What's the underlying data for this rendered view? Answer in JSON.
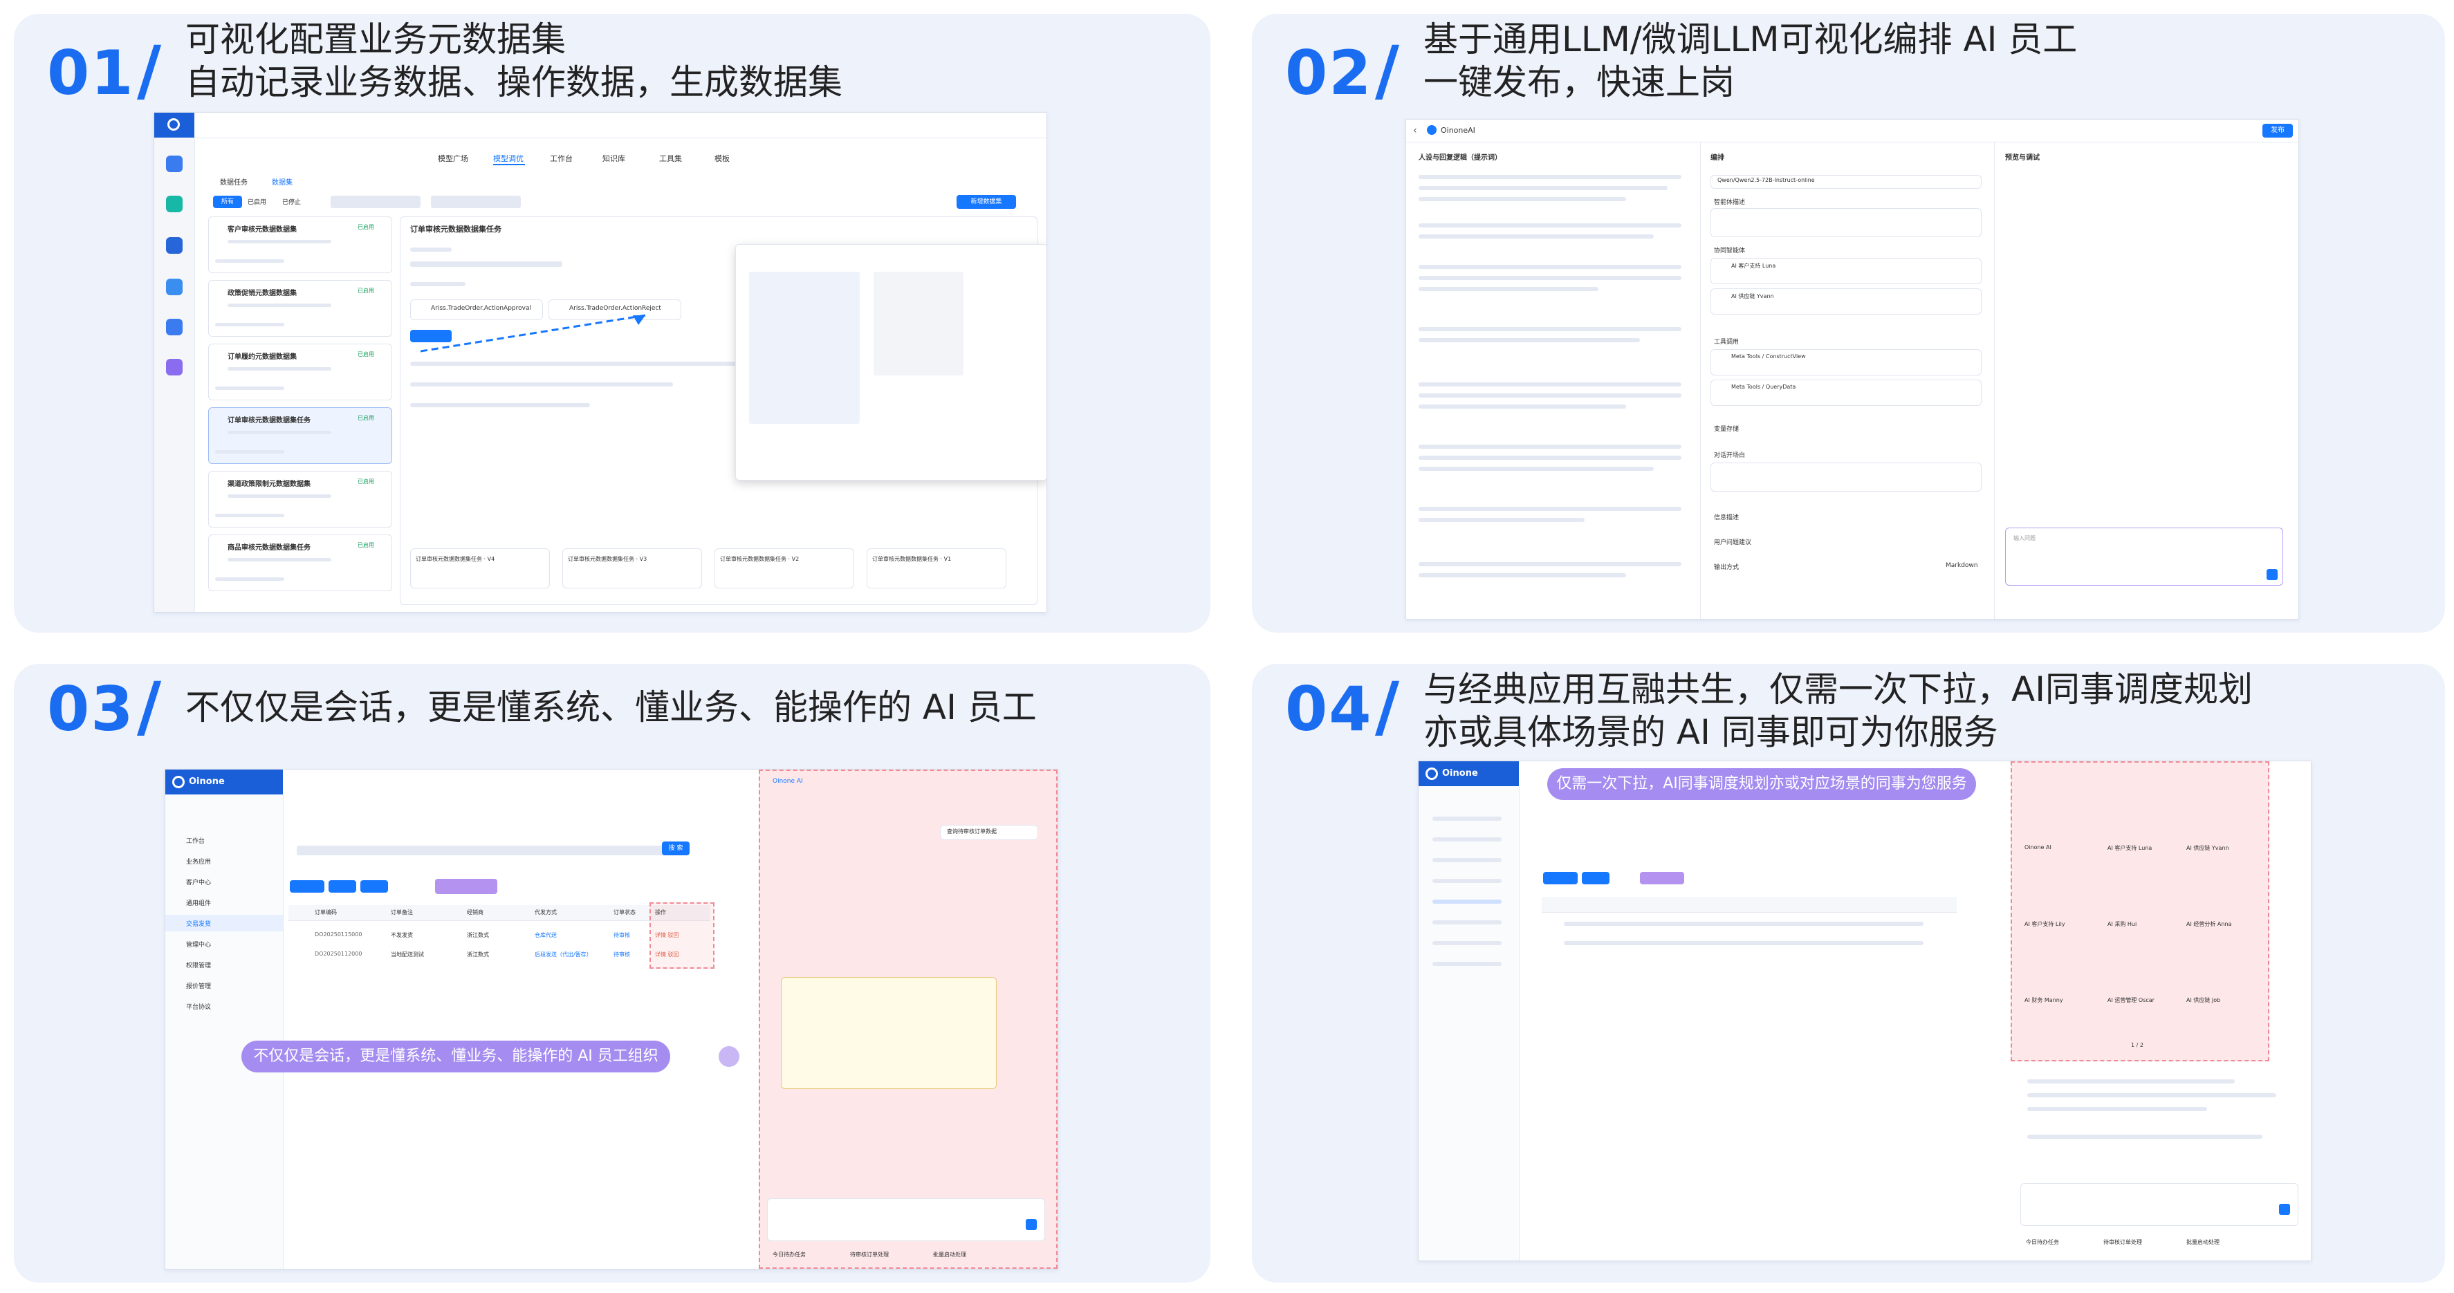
{
  "cards": [
    {
      "num": "01",
      "slash": "/",
      "title_line1": "可视化配置业务元数据集",
      "title_line2": "自动记录业务数据、操作数据，生成数据集",
      "screen": {
        "top_tabs": [
          "模型广场",
          "模型调优",
          "工作台",
          "知识库",
          "工具集",
          "模板"
        ],
        "sub_tabs": [
          "数据任务",
          "数据集"
        ],
        "filters": [
          "所有",
          "已启用",
          "已停止"
        ],
        "new_button": "新增数据集",
        "list_items": [
          {
            "title": "客户审核元数据数据集",
            "badge": "已启用"
          },
          {
            "title": "政策促销元数据数据集",
            "badge": "已启用"
          },
          {
            "title": "订单履约元数据数据集",
            "badge": "已启用"
          },
          {
            "title": "订单审核元数据数据集任务",
            "badge": "已启用"
          },
          {
            "title": "渠道政策限制元数据数据集",
            "badge": "已启用"
          },
          {
            "title": "商品审核元数据数据集任务",
            "badge": "已启用"
          }
        ],
        "detail_title": "订单审核元数据数据集任务",
        "action_a": "Ariss.TradeOrder.ActionApproval",
        "action_b": "Ariss.TradeOrder.ActionReject",
        "dataset_cards": [
          "订单审核元数据数据集任务 · V4",
          "订单审核元数据数据集任务 · V3",
          "订单审核元数据数据集任务 · V2",
          "订单审核元数据数据集任务 · V1"
        ]
      }
    },
    {
      "num": "02",
      "slash": "/",
      "title_line1": "基于通用LLM/微调LLM可视化编排 AI 员工",
      "title_line2": "一键发布，快速上岗",
      "screen": {
        "app_name": "OinoneAI",
        "publish": "发布",
        "col1_title": "人设与回复逻辑（提示词）",
        "col2_title": "编排",
        "col3_title": "预览与调试",
        "model_name": "Qwen/Qwen2.5-72B-Instruct-online",
        "sections": [
          "智能体描述",
          "协同智能体",
          "工具调用",
          "变量存储",
          "对话开场白",
          "信息描述",
          "用户问题建议",
          "输出方式"
        ],
        "agents": [
          "AI 客户支持 Luna",
          "AI 供应链 Yvann"
        ],
        "tools": [
          "Meta Tools / ConstructView",
          "Meta Tools / QueryData"
        ],
        "output_mode": "Markdown",
        "input_placeholder": "输入问题"
      }
    },
    {
      "num": "03",
      "slash": "/",
      "title_line1": "不仅仅是会话，更是懂系统、懂业务、能操作的 AI 员工",
      "title_line2": "",
      "screen": {
        "brand": "Oinone",
        "menu": [
          "工作台",
          "业务应用",
          "客户中心",
          "通用组件",
          "交易发货",
          "管理中心",
          "权限管理",
          "报价管理",
          "平台协议"
        ],
        "columns": [
          "订单编码",
          "订单备注",
          "经销商",
          "代发方式",
          "订单状态",
          "操作"
        ],
        "rows": [
          [
            "DO20250115000",
            "不发发货",
            "浙江数式",
            "仓库代送",
            "待审核",
            "详情  驳回"
          ],
          [
            "DO20250112000",
            "当地配送测试",
            "浙江数式",
            "后段发送（代出/暂存）",
            "待审核",
            "详情  驳回"
          ]
        ],
        "search_btn": "搜 索",
        "callout": "不仅仅是会话，更是懂系统、懂业务、能操作的 AI 员工组织",
        "chat_title": "Oinone AI",
        "chat_q": "查询待审核订单数据",
        "chat_tags": [
          "今日待办任务",
          "待审核订单处理",
          "批量启动处理"
        ]
      }
    },
    {
      "num": "04",
      "slash": "/",
      "title_line1": "与经典应用互融共生，仅需一次下拉，AI同事调度规划",
      "title_line2": "亦或具体场景的 AI 同事即可为你服务",
      "screen": {
        "brand": "Oinone",
        "callout": "仅需一次下拉，AI同事调度规划亦或对应场景的同事为您服务",
        "agents": [
          "Oinone AI",
          "AI 客户支持 Luna",
          "AI 供应链 Yvann",
          "AI 客户支持 Lily",
          "AI 采购 Hui",
          "AI 经营分析 Anna",
          "AI 财务 Manny",
          "AI 运营管理 Oscar",
          "AI 供应链 Job"
        ],
        "chat_tags": [
          "今日待办任务",
          "待审核订单处理",
          "批量启动处理"
        ],
        "pager": "1 / 2"
      }
    }
  ]
}
